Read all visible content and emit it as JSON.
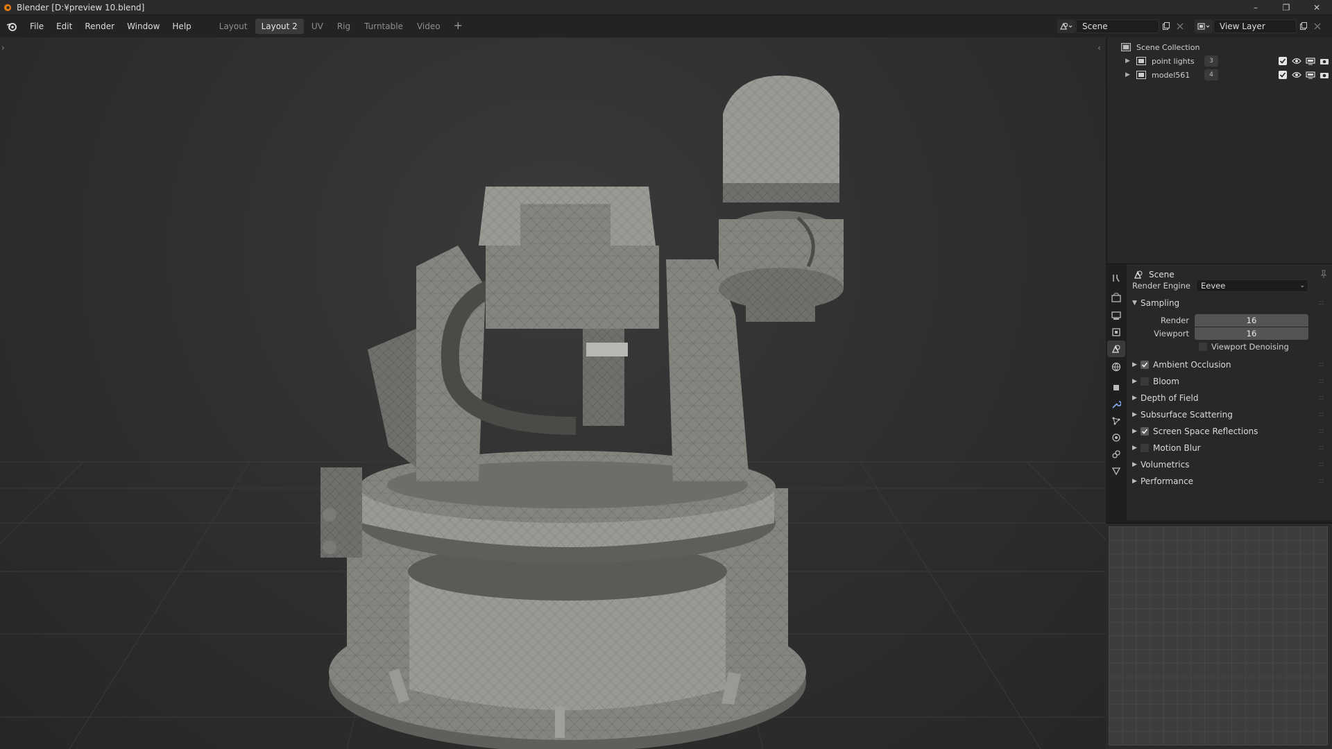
{
  "window": {
    "title": "Blender [D:¥preview 10.blend]",
    "controls": [
      "–",
      "❐",
      "✕"
    ]
  },
  "menu": [
    "File",
    "Edit",
    "Render",
    "Window",
    "Help"
  ],
  "workspaces": {
    "tabs": [
      "Layout",
      "Layout 2",
      "UV",
      "Rig",
      "Turntable",
      "Video"
    ],
    "active": "Layout 2",
    "add_label": "+"
  },
  "scene_selector": {
    "value": "Scene"
  },
  "view_layer_selector": {
    "value": "View Layer"
  },
  "outliner": {
    "root": "Scene Collection",
    "items": [
      {
        "label": "point lights",
        "badge": "3"
      },
      {
        "label": "model561",
        "badge": "4"
      }
    ]
  },
  "properties": {
    "context_title": "Scene",
    "render_engine_label": "Render Engine",
    "render_engine_value": "Eevee",
    "sampling": {
      "title": "Sampling",
      "render_label": "Render",
      "render_value": "16",
      "viewport_label": "Viewport",
      "viewport_value": "16",
      "denoise_label": "Viewport Denoising",
      "denoise_checked": false
    },
    "panels": [
      {
        "label": "Ambient Occlusion",
        "checkbox": true,
        "checked": true
      },
      {
        "label": "Bloom",
        "checkbox": true,
        "checked": false
      },
      {
        "label": "Depth of Field",
        "checkbox": false
      },
      {
        "label": "Subsurface Scattering",
        "checkbox": false
      },
      {
        "label": "Screen Space Reflections",
        "checkbox": true,
        "checked": true
      },
      {
        "label": "Motion Blur",
        "checkbox": true,
        "checked": false
      },
      {
        "label": "Volumetrics",
        "checkbox": false
      },
      {
        "label": "Performance",
        "checkbox": false
      }
    ]
  },
  "colors": {
    "accent": "#e87d0d",
    "panel": "#282828",
    "viewport": "#303030",
    "model": "#8a8a84"
  }
}
